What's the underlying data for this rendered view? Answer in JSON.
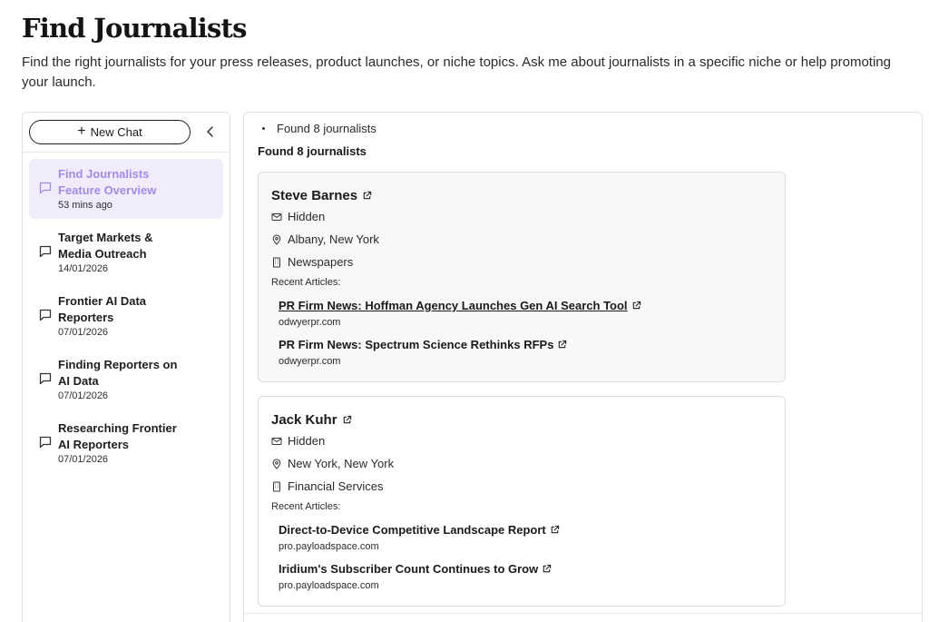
{
  "page": {
    "title": "Find Journalists",
    "description": "Find the right journalists for your press releases, product launches, or niche topics. Ask me about journalists in a specific niche or help promoting your launch."
  },
  "sidebar": {
    "new_chat_label": "New Chat",
    "collapse_icon": "chevron-left-icon",
    "chats": [
      {
        "title": "Find Journalists Feature Overview",
        "date": "53 mins ago",
        "active": true
      },
      {
        "title": "Target Markets & Media Outreach",
        "date": "14/01/2026",
        "active": false
      },
      {
        "title": "Frontier AI Data Reporters",
        "date": "07/01/2026",
        "active": false
      },
      {
        "title": "Finding Reporters on AI Data",
        "date": "07/01/2026",
        "active": false
      },
      {
        "title": "Researching Frontier AI Reporters",
        "date": "07/01/2026",
        "active": false
      }
    ]
  },
  "main": {
    "status": "Found 8 journalists",
    "heading": "Found 8 journalists",
    "recent_label": "Recent Articles:",
    "journalists": [
      {
        "name": "Steve Barnes",
        "email": "Hidden",
        "location": "Albany, New York",
        "outlet_type": "Newspapers",
        "articles": [
          {
            "title": "PR Firm News: Hoffman Agency Launches Gen AI Search Tool",
            "domain": "odwyerpr.com"
          },
          {
            "title": "PR Firm News: Spectrum Science Rethinks RFPs",
            "domain": "odwyerpr.com"
          }
        ]
      },
      {
        "name": "Jack Kuhr",
        "email": "Hidden",
        "location": "New York, New York",
        "outlet_type": "Financial Services",
        "articles": [
          {
            "title": "Direct-to-Device Competitive Landscape Report",
            "domain": "pro.payloadspace.com"
          },
          {
            "title": "Iridium's Subscriber Count Continues to Grow",
            "domain": "pro.payloadspace.com"
          }
        ]
      }
    ]
  },
  "colors": {
    "active_chat_bg": "#f0ecfb",
    "active_chat_text": "#a48ae6",
    "border": "#e2e2e2"
  }
}
